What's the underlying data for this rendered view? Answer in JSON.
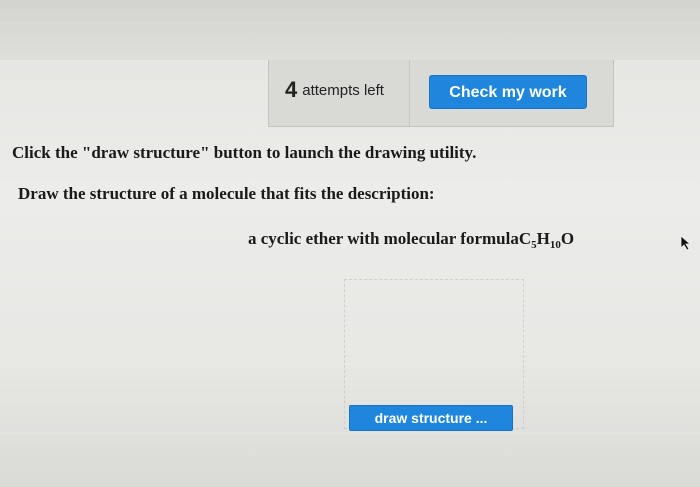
{
  "header": {
    "attempts_count": "4",
    "attempts_label": "attempts left",
    "check_button_label": "Check my work"
  },
  "instructions": {
    "line1": "Click the \"draw structure\" button to launch the drawing utility.",
    "line2": "Draw the structure of a molecule that fits the description:"
  },
  "question": {
    "description": "a cyclic ether with molecular formula",
    "formula": {
      "el1": "C",
      "n1": "5",
      "el2": "H",
      "n2": "10",
      "el3": "O"
    }
  },
  "draw_button_label": "draw structure ...",
  "colors": {
    "button_blue": "#1e86dc",
    "panel_gray": "#d9d9d6",
    "text_dark": "#1a1a1a"
  },
  "icons": {
    "cursor": "mouse-pointer-icon"
  }
}
